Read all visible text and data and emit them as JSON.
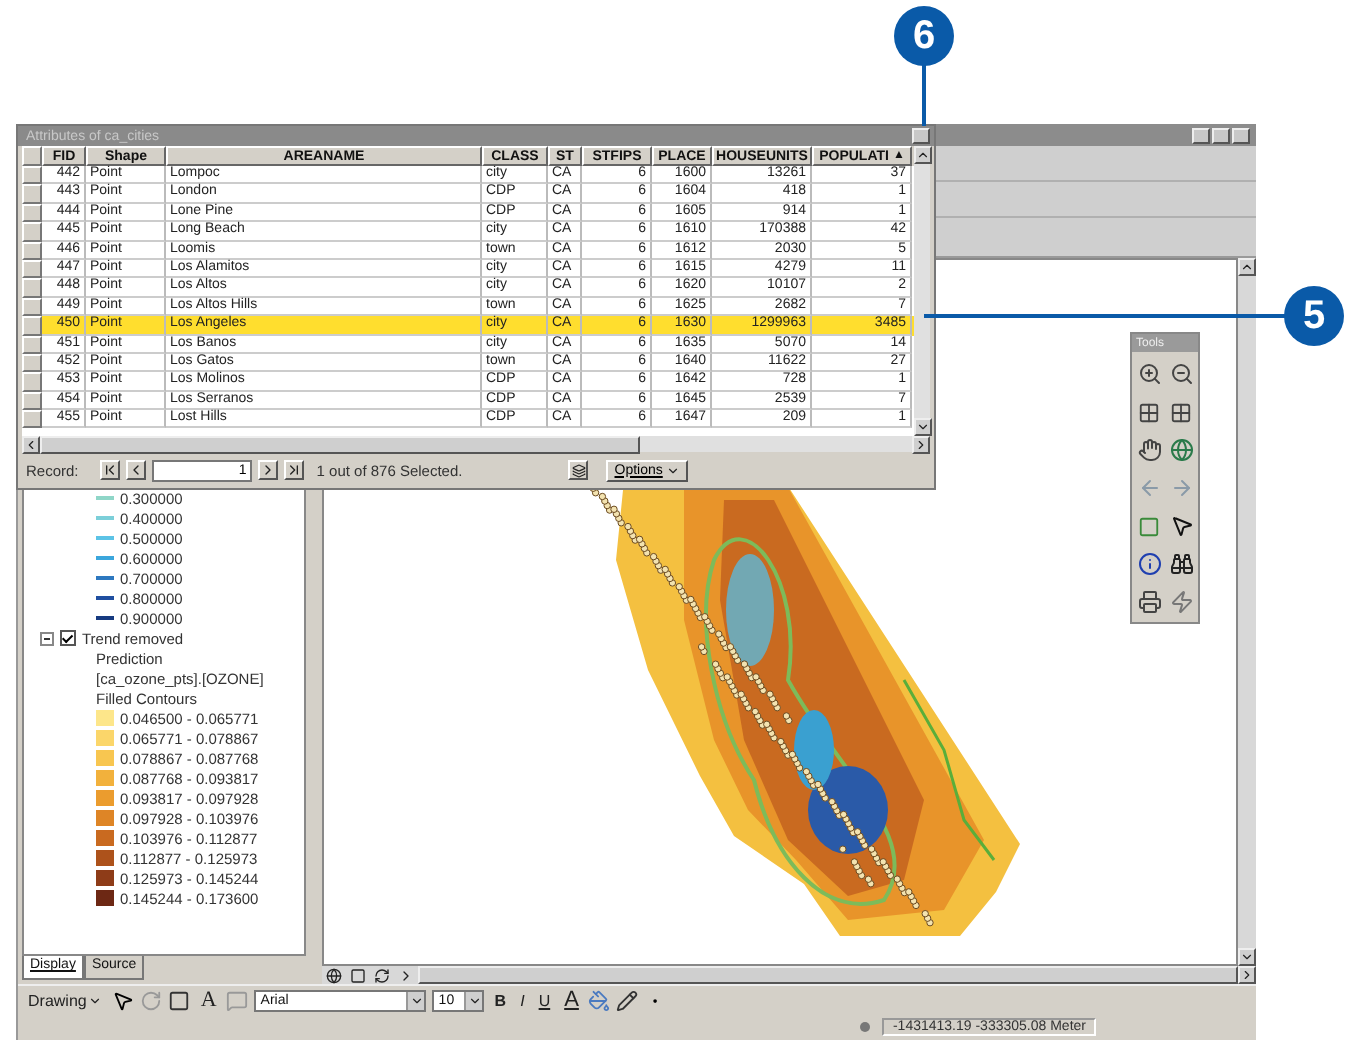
{
  "callouts": [
    {
      "label": "6"
    },
    {
      "label": "5"
    }
  ],
  "table_window": {
    "title": "Attributes of ca_cities",
    "columns": [
      "FID",
      "Shape",
      "AREANAME",
      "CLASS",
      "ST",
      "STFIPS",
      "PLACE",
      "HOUSEUNITS",
      "POPULATI"
    ],
    "sort_arrow": "▲",
    "rows": [
      {
        "cells": [
          "442",
          "Point",
          "Lompoc",
          "city",
          "CA",
          "6",
          "1600",
          "13261",
          "37"
        ],
        "selected": false
      },
      {
        "cells": [
          "443",
          "Point",
          "London",
          "CDP",
          "CA",
          "6",
          "1604",
          "418",
          "1"
        ],
        "selected": false
      },
      {
        "cells": [
          "444",
          "Point",
          "Lone Pine",
          "CDP",
          "CA",
          "6",
          "1605",
          "914",
          "1"
        ],
        "selected": false
      },
      {
        "cells": [
          "445",
          "Point",
          "Long Beach",
          "city",
          "CA",
          "6",
          "1610",
          "170388",
          "42"
        ],
        "selected": false
      },
      {
        "cells": [
          "446",
          "Point",
          "Loomis",
          "town",
          "CA",
          "6",
          "1612",
          "2030",
          "5"
        ],
        "selected": false
      },
      {
        "cells": [
          "447",
          "Point",
          "Los Alamitos",
          "city",
          "CA",
          "6",
          "1615",
          "4279",
          "11"
        ],
        "selected": false
      },
      {
        "cells": [
          "448",
          "Point",
          "Los Altos",
          "city",
          "CA",
          "6",
          "1620",
          "10107",
          "2"
        ],
        "selected": false
      },
      {
        "cells": [
          "449",
          "Point",
          "Los Altos Hills",
          "town",
          "CA",
          "6",
          "1625",
          "2682",
          "7"
        ],
        "selected": false
      },
      {
        "cells": [
          "450",
          "Point",
          "Los Angeles",
          "city",
          "CA",
          "6",
          "1630",
          "1299963",
          "3485"
        ],
        "selected": true
      },
      {
        "cells": [
          "451",
          "Point",
          "Los Banos",
          "city",
          "CA",
          "6",
          "1635",
          "5070",
          "14"
        ],
        "selected": false
      },
      {
        "cells": [
          "452",
          "Point",
          "Los Gatos",
          "town",
          "CA",
          "6",
          "1640",
          "11622",
          "27"
        ],
        "selected": false
      },
      {
        "cells": [
          "453",
          "Point",
          "Los Molinos",
          "CDP",
          "CA",
          "6",
          "1642",
          "728",
          "1"
        ],
        "selected": false
      },
      {
        "cells": [
          "454",
          "Point",
          "Los Serranos",
          "CDP",
          "CA",
          "6",
          "1645",
          "2539",
          "7"
        ],
        "selected": false
      },
      {
        "cells": [
          "455",
          "Point",
          "Lost Hills",
          "CDP",
          "CA",
          "6",
          "1647",
          "209",
          "1"
        ],
        "selected": false
      }
    ],
    "record_label": "Record:",
    "record_value": "1",
    "selection_status": "1 out of 876 Selected.",
    "options_button": "Options"
  },
  "toc": {
    "contour_values": [
      {
        "label": "0.300000",
        "color": "#8fd6c8"
      },
      {
        "label": "0.400000",
        "color": "#7ccfd9"
      },
      {
        "label": "0.500000",
        "color": "#5cc3e6"
      },
      {
        "label": "0.600000",
        "color": "#3ba6dc"
      },
      {
        "label": "0.700000",
        "color": "#2d78bf"
      },
      {
        "label": "0.800000",
        "color": "#1f4fa0"
      },
      {
        "label": "0.900000",
        "color": "#163a80"
      }
    ],
    "layer": {
      "name": "Trend removed",
      "checked": true,
      "expanded": true,
      "lines": [
        "Prediction",
        "[ca_ozone_pts].[OZONE]",
        "Filled Contours"
      ],
      "ranges": [
        {
          "label": "0.046500 - 0.065771",
          "color": "#fde68a"
        },
        {
          "label": "0.065771 - 0.078867",
          "color": "#fbd66a"
        },
        {
          "label": "0.078867 - 0.087768",
          "color": "#f8c650"
        },
        {
          "label": "0.087768 - 0.093817",
          "color": "#f2b13c"
        },
        {
          "label": "0.093817 - 0.097928",
          "color": "#eb9c2e"
        },
        {
          "label": "0.097928 - 0.103976",
          "color": "#de8526"
        },
        {
          "label": "0.103976 - 0.112877",
          "color": "#c96a20"
        },
        {
          "label": "0.112877 - 0.125973",
          "color": "#ad521b"
        },
        {
          "label": "0.125973 - 0.145244",
          "color": "#8e3c18"
        },
        {
          "label": "0.145244 - 0.173600",
          "color": "#6d2814"
        }
      ]
    },
    "tabs": [
      {
        "label": "Display",
        "selected": true
      },
      {
        "label": "Source",
        "selected": false
      }
    ]
  },
  "tools_palette": {
    "title": "Tools"
  },
  "drawing_toolbar": {
    "menu": "Drawing",
    "text_tool": "A",
    "font": "Arial",
    "size": "10",
    "bold": "B",
    "italic": "I",
    "underline": "U",
    "font_color": "A"
  },
  "status_bar": {
    "coordinates": "-1431413.19  -333305.08 Meter"
  }
}
